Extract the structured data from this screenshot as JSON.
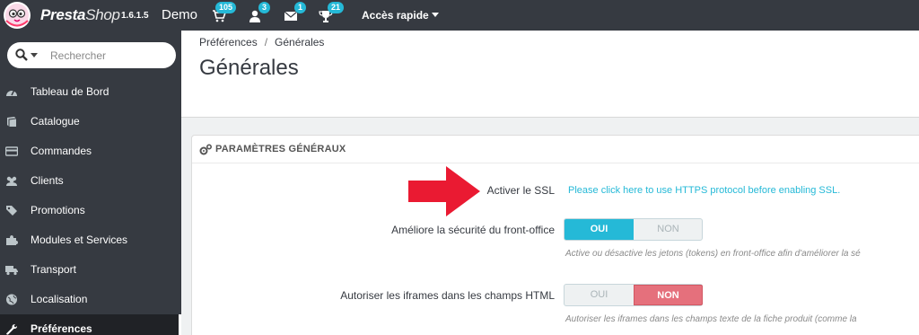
{
  "topbar": {
    "brand_presta": "Presta",
    "brand_shop": "Shop",
    "version": "1.6.1.5",
    "shop_name": "Demo",
    "badges": {
      "orders": "105",
      "customers": "3",
      "messages": "1",
      "trophies": "21"
    },
    "quick_access": "Accès rapide"
  },
  "search": {
    "placeholder": "Rechercher"
  },
  "sidebar": {
    "items": [
      {
        "label": "Tableau de Bord",
        "icon": "dashboard-icon"
      },
      {
        "label": "Catalogue",
        "icon": "book-icon"
      },
      {
        "label": "Commandes",
        "icon": "credit-card-icon"
      },
      {
        "label": "Clients",
        "icon": "users-icon"
      },
      {
        "label": "Promotions",
        "icon": "tag-icon"
      },
      {
        "label": "Modules et Services",
        "icon": "puzzle-icon"
      },
      {
        "label": "Transport",
        "icon": "truck-icon"
      },
      {
        "label": "Localisation",
        "icon": "globe-icon"
      },
      {
        "label": "Préférences",
        "icon": "wrench-icon",
        "active": true
      }
    ]
  },
  "breadcrumb": {
    "parent": "Préférences",
    "sep": "/",
    "current": "Générales"
  },
  "page_title": "Générales",
  "panel": {
    "title": "PARAMÈTRES GÉNÉRAUX",
    "ssl": {
      "label": "Activer le SSL",
      "link": "Please click here to use HTTPS protocol before enabling SSL."
    },
    "security": {
      "label": "Améliore la sécurité du front-office",
      "on": "OUI",
      "off": "NON",
      "value": "OUI",
      "help": "Active ou désactive les jetons (tokens) en front-office afin d'améliorer la sé"
    },
    "iframes": {
      "label": "Autoriser les iframes dans les champs HTML",
      "on": "OUI",
      "off": "NON",
      "value": "NON",
      "help": "Autoriser les iframes dans les champs texte de la fiche produit (comme la"
    }
  },
  "colors": {
    "accent": "#25b9d7",
    "sidebar": "#363a41",
    "arrow": "#ea1a32",
    "no_active": "#e5707c"
  }
}
